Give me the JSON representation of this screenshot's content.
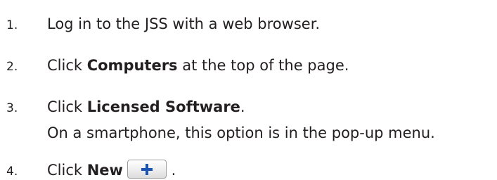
{
  "steps": [
    {
      "number": "1.",
      "text": "Log in to the JSS with a web browser."
    },
    {
      "number": "2.",
      "prefix": "Click ",
      "bold": "Computers",
      "suffix": " at the top of the page."
    },
    {
      "number": "3.",
      "prefix": "Click ",
      "bold": "Licensed Software",
      "suffix": ".",
      "note": "On a smartphone, this option is in the pop-up menu."
    },
    {
      "number": "4.",
      "prefix": "Click ",
      "bold": "New",
      "suffix": " .",
      "icon": "plus-icon"
    }
  ],
  "colors": {
    "text": "#231f20",
    "icon_blue": "#1a55b3"
  }
}
